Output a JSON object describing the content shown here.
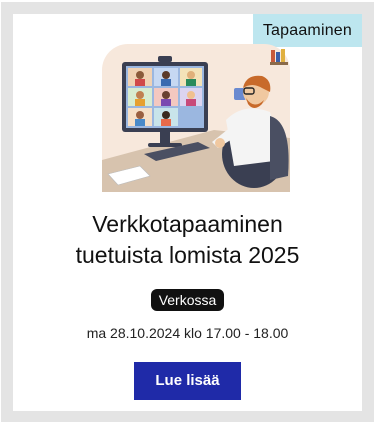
{
  "card": {
    "tag": "Tapaaminen",
    "title_line1": "Verkkotapaaminen",
    "title_line2": "tuetuista lomista 2025",
    "badge": "Verkossa",
    "datetime": "ma 28.10.2024 klo 17.00 - 18.00",
    "button_label": "Lue lisää"
  },
  "colors": {
    "tag_bg": "#bde6ef",
    "badge_bg": "#111111",
    "button_bg": "#1f2aa8",
    "frame_bg": "#e4e4e4"
  },
  "icons": {
    "illustration": "video-meeting-illustration"
  }
}
